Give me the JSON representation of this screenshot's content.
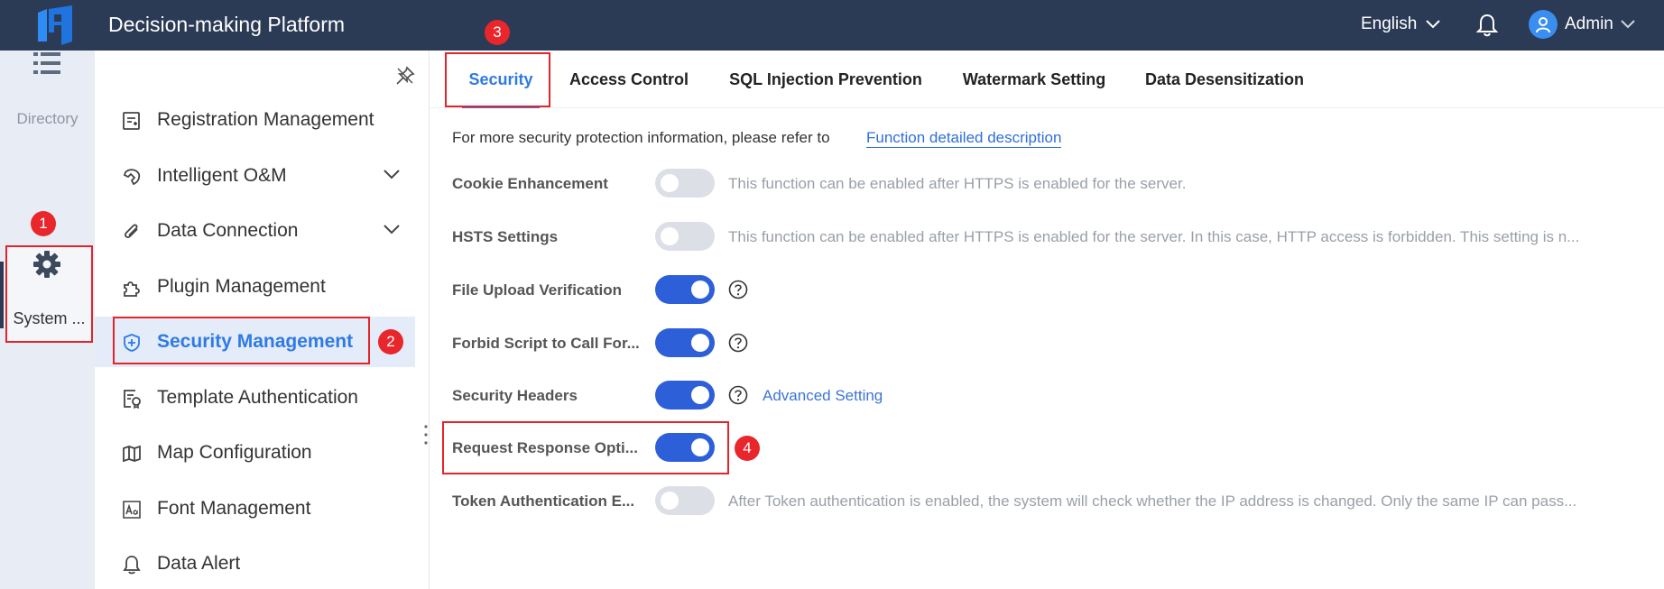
{
  "header": {
    "app_title": "Decision-making Platform",
    "language": "English",
    "user_name": "Admin",
    "bg_color": "#2b3a55"
  },
  "rail": {
    "directory_label": "Directory",
    "system_label": "System ..."
  },
  "sidebar": {
    "items": [
      {
        "label": "Registration Management",
        "icon": "registration-icon",
        "expandable": false,
        "active": false
      },
      {
        "label": "Intelligent O&M",
        "icon": "om-icon",
        "expandable": true,
        "active": false
      },
      {
        "label": "Data Connection",
        "icon": "data-connection-icon",
        "expandable": true,
        "active": false
      },
      {
        "label": "Plugin Management",
        "icon": "plugin-icon",
        "expandable": false,
        "active": false
      },
      {
        "label": "Security Management",
        "icon": "shield-icon",
        "expandable": false,
        "active": true
      },
      {
        "label": "Template Authentication",
        "icon": "template-auth-icon",
        "expandable": false,
        "active": false
      },
      {
        "label": "Map Configuration",
        "icon": "map-icon",
        "expandable": false,
        "active": false
      },
      {
        "label": "Font Management",
        "icon": "font-icon",
        "expandable": false,
        "active": false
      },
      {
        "label": "Data Alert",
        "icon": "bell-icon",
        "expandable": false,
        "active": false
      }
    ]
  },
  "tabs": [
    {
      "label": "Security",
      "active": true
    },
    {
      "label": "Access Control",
      "active": false
    },
    {
      "label": "SQL Injection Prevention",
      "active": false
    },
    {
      "label": "Watermark Setting",
      "active": false
    },
    {
      "label": "Data Desensitization",
      "active": false
    }
  ],
  "main": {
    "intro_text": "For more security protection information, please refer to",
    "intro_link": "Function detailed description",
    "rows": [
      {
        "label": "Cookie Enhancement",
        "enabled": false,
        "description": "This function can be enabled after HTTPS is enabled for the server."
      },
      {
        "label": "HSTS Settings",
        "enabled": false,
        "description": "This function can be enabled after HTTPS is enabled for the server. In this case, HTTP access is forbidden. This setting is n..."
      },
      {
        "label": "File Upload Verification",
        "enabled": true,
        "help": true
      },
      {
        "label": "Forbid Script to Call For...",
        "enabled": true,
        "help": true
      },
      {
        "label": "Security Headers",
        "enabled": true,
        "help": true,
        "link": "Advanced Setting"
      },
      {
        "label": "Request Response Opti...",
        "enabled": true
      },
      {
        "label": "Token Authentication E...",
        "enabled": false,
        "description": "After Token authentication is enabled, the system will check whether the IP address is changed. Only the same IP can pass..."
      }
    ]
  },
  "annotations": [
    "1",
    "2",
    "3",
    "4"
  ],
  "colors": {
    "accent": "#2f7ae5",
    "toggle_on": "#2d5fd8",
    "toggle_off": "#dcdfe5",
    "annotation": "#e3242b"
  }
}
